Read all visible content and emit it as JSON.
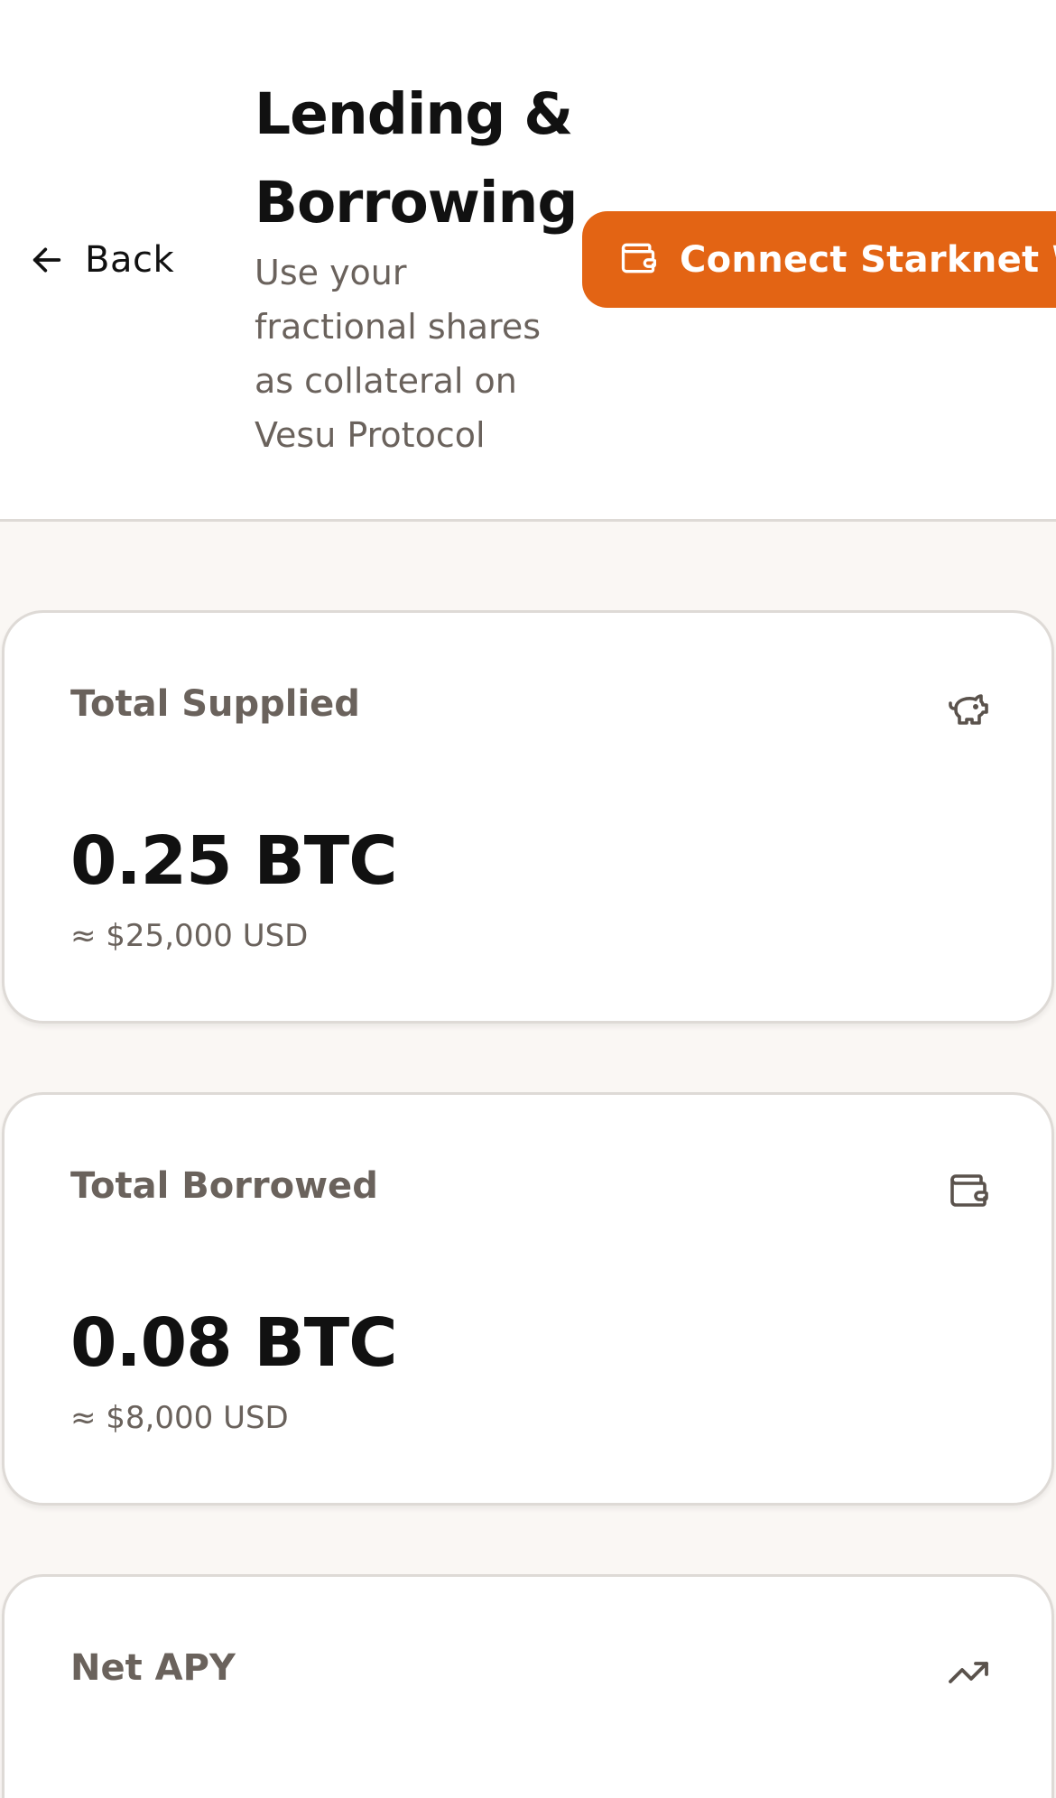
{
  "header": {
    "back_label": "Back",
    "title": "Lending & Borrowing",
    "subtitle": "Use your fractional shares as collateral on Vesu Protocol",
    "connect_button_label": "Connect Starknet Wallet",
    "accent_color": "#e36414"
  },
  "stats": [
    {
      "label": "Total Supplied",
      "icon": "piggy-bank-icon",
      "value": "0.25 BTC",
      "sub": "≈ $25,000 USD"
    },
    {
      "label": "Total Borrowed",
      "icon": "wallet-icon",
      "value": "0.08 BTC",
      "sub": "≈ $8,000 USD"
    },
    {
      "label": "Net APY",
      "icon": "trending-up-icon"
    }
  ]
}
